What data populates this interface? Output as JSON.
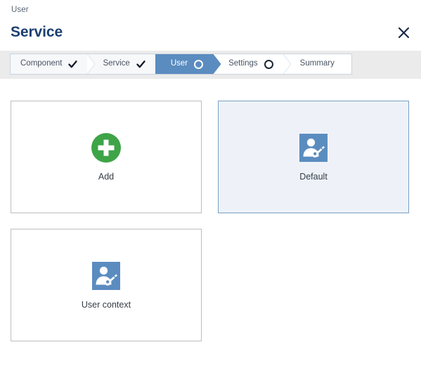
{
  "header": {
    "breadcrumb": "User",
    "title": "Service",
    "close_icon": "close-icon",
    "close_label": "×"
  },
  "wizard": {
    "steps": [
      {
        "label": "Component",
        "state": "completed",
        "icon": "check-icon"
      },
      {
        "label": "Service",
        "state": "completed",
        "icon": "check-icon"
      },
      {
        "label": "User",
        "state": "active",
        "icon": "circle-outline-icon"
      },
      {
        "label": "Settings",
        "state": "pending",
        "icon": "circle-outline-icon"
      },
      {
        "label": "Summary",
        "state": "pending",
        "icon": "none"
      }
    ]
  },
  "cards": [
    {
      "label": "Add",
      "icon": "plus-circle-icon",
      "selected": false
    },
    {
      "label": "Default",
      "icon": "user-key-icon",
      "selected": true
    },
    {
      "label": "User context",
      "icon": "user-key-icon",
      "selected": false
    }
  ],
  "colors": {
    "title": "#1c3f72",
    "breadcrumb": "#5a6673",
    "wizard_bar_bg": "#ebebeb",
    "wizard_step_bg": "#f6f8fa",
    "wizard_active_bg": "#5b8cc0",
    "wizard_border": "#c9d3de",
    "card_border": "#bdbdbd",
    "card_selected_border": "#7a9fc4",
    "card_selected_bg": "#eef2f8",
    "add_green": "#3ea447",
    "icon_blue": "#5b8cc0",
    "label_text": "#333d47"
  }
}
